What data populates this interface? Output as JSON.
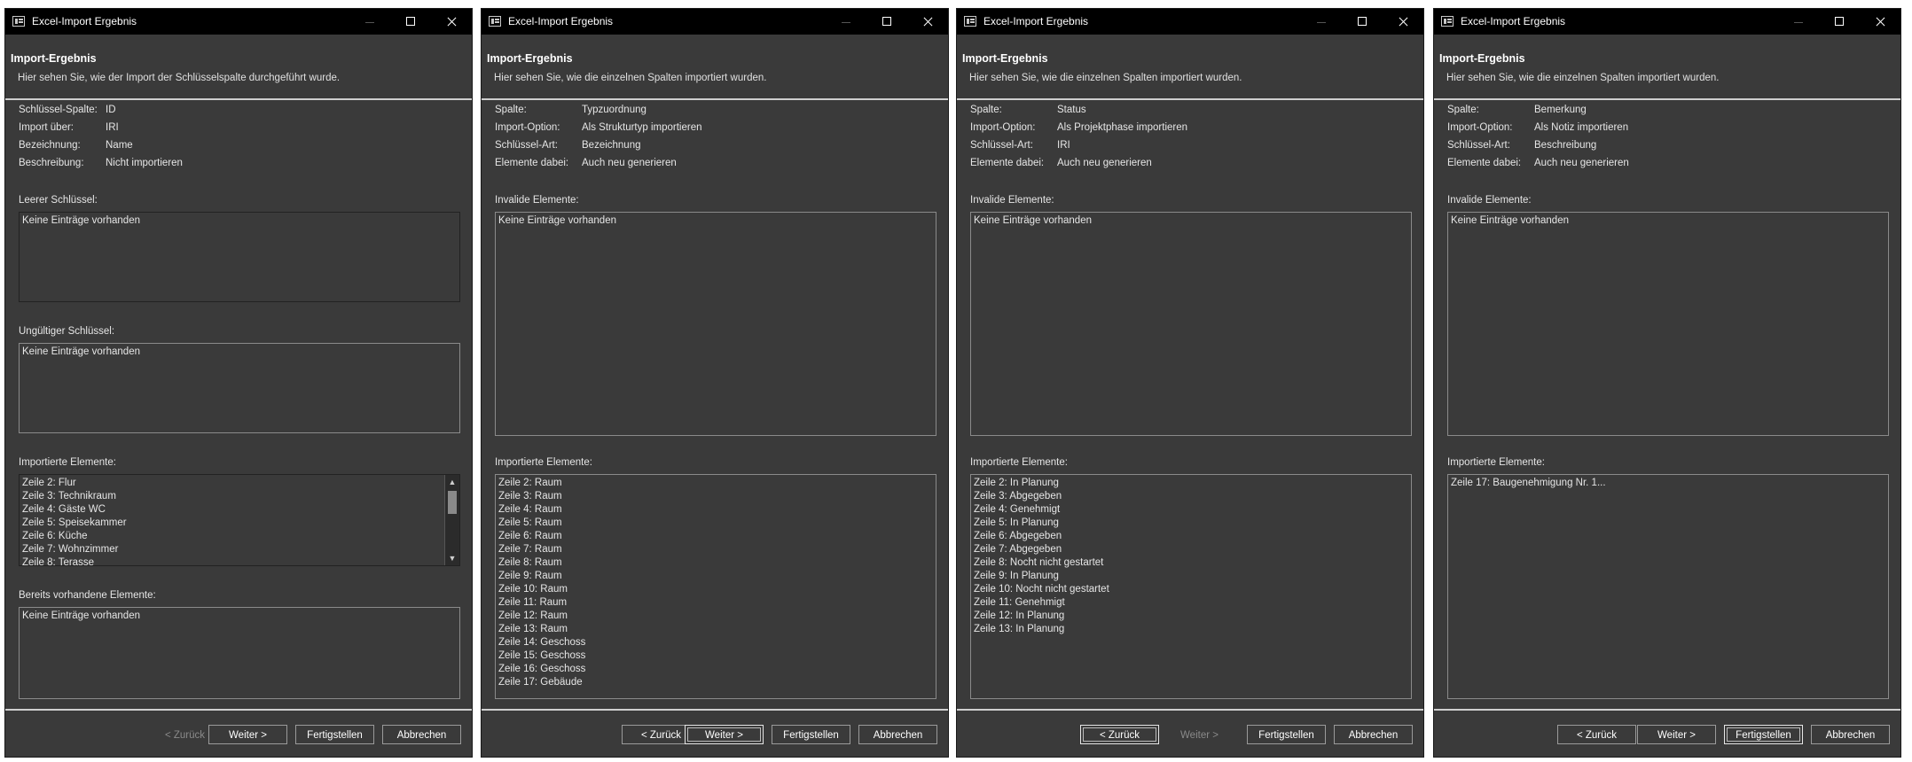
{
  "windows": [
    {
      "title": "Excel-Import Ergebnis",
      "header": {
        "title": "Import-Ergebnis",
        "desc": "Hier sehen Sie, wie der Import der Schlüsselspalte durchgeführt wurde."
      },
      "info": [
        {
          "label": "Schlüssel-Spalte:",
          "value": "ID"
        },
        {
          "label": "Import über:",
          "value": "IRI"
        },
        {
          "label": "Bezeichnung:",
          "value": "Name"
        },
        {
          "label": "Beschreibung:",
          "value": "Nicht importieren"
        }
      ],
      "sections": [
        {
          "label": "Leerer Schlüssel:",
          "items": [
            "Keine Einträge vorhanden"
          ]
        },
        {
          "label": "Ungültiger Schlüssel:",
          "items": [
            "Keine Einträge vorhanden"
          ]
        },
        {
          "label": "Importierte Elemente:",
          "items": [
            "Zeile 2: Flur",
            "Zeile 3: Technikraum",
            "Zeile 4: Gäste WC",
            "Zeile 5: Speisekammer",
            "Zeile 6: Küche",
            "Zeile 7: Wohnzimmer",
            "Zeile 8: Terasse"
          ]
        },
        {
          "label": "Bereits vorhandene Elemente:",
          "items": [
            "Keine Einträge vorhanden"
          ]
        }
      ],
      "buttons": {
        "back": "< Zurück",
        "next": "Weiter >",
        "finish": "Fertigstellen",
        "cancel": "Abbrechen"
      }
    },
    {
      "title": "Excel-Import Ergebnis",
      "header": {
        "title": "Import-Ergebnis",
        "desc": "Hier sehen Sie, wie die einzelnen Spalten importiert wurden."
      },
      "info": [
        {
          "label": "Spalte:",
          "value": "Typzuordnung"
        },
        {
          "label": "Import-Option:",
          "value": "Als Strukturtyp importieren"
        },
        {
          "label": "Schlüssel-Art:",
          "value": "Bezeichnung"
        },
        {
          "label": "Elemente dabei:",
          "value": "Auch neu generieren"
        }
      ],
      "sections": [
        {
          "label": "Invalide Elemente:",
          "items": [
            "Keine Einträge vorhanden"
          ]
        },
        {
          "label": "Importierte Elemente:",
          "items": [
            "Zeile 2: Raum",
            "Zeile 3: Raum",
            "Zeile 4: Raum",
            "Zeile 5: Raum",
            "Zeile 6: Raum",
            "Zeile 7: Raum",
            "Zeile 8: Raum",
            "Zeile 9: Raum",
            "Zeile 10: Raum",
            "Zeile 11: Raum",
            "Zeile 12: Raum",
            "Zeile 13: Raum",
            "Zeile 14: Geschoss",
            "Zeile 15: Geschoss",
            "Zeile 16: Geschoss",
            "Zeile 17: Gebäude"
          ]
        }
      ],
      "buttons": {
        "back": "< Zurück",
        "next": "Weiter >",
        "finish": "Fertigstellen",
        "cancel": "Abbrechen"
      }
    },
    {
      "title": "Excel-Import Ergebnis",
      "header": {
        "title": "Import-Ergebnis",
        "desc": "Hier sehen Sie, wie die einzelnen Spalten importiert wurden."
      },
      "info": [
        {
          "label": "Spalte:",
          "value": "Status"
        },
        {
          "label": "Import-Option:",
          "value": "Als Projektphase importieren"
        },
        {
          "label": "Schlüssel-Art:",
          "value": "IRI"
        },
        {
          "label": "Elemente dabei:",
          "value": "Auch neu generieren"
        }
      ],
      "sections": [
        {
          "label": "Invalide Elemente:",
          "items": [
            "Keine Einträge vorhanden"
          ]
        },
        {
          "label": "Importierte Elemente:",
          "items": [
            "Zeile 2: In Planung",
            "Zeile 3: Abgegeben",
            "Zeile 4: Genehmigt",
            "Zeile 5: In Planung",
            "Zeile 6: Abgegeben",
            "Zeile 7: Abgegeben",
            "Zeile 8: Nocht nicht gestartet",
            "Zeile 9: In Planung",
            "Zeile 10: Nocht nicht gestartet",
            "Zeile 11: Genehmigt",
            "Zeile 12: In Planung",
            "Zeile 13: In Planung"
          ]
        }
      ],
      "buttons": {
        "back": "< Zurück",
        "next": "Weiter >",
        "finish": "Fertigstellen",
        "cancel": "Abbrechen"
      }
    },
    {
      "title": "Excel-Import Ergebnis",
      "header": {
        "title": "Import-Ergebnis",
        "desc": "Hier sehen Sie, wie die einzelnen Spalten importiert wurden."
      },
      "info": [
        {
          "label": "Spalte:",
          "value": "Bemerkung"
        },
        {
          "label": "Import-Option:",
          "value": "Als Notiz importieren"
        },
        {
          "label": "Schlüssel-Art:",
          "value": "Beschreibung"
        },
        {
          "label": "Elemente dabei:",
          "value": "Auch neu generieren"
        }
      ],
      "sections": [
        {
          "label": "Invalide Elemente:",
          "items": [
            "Keine Einträge vorhanden"
          ]
        },
        {
          "label": "Importierte Elemente:",
          "items": [
            "Zeile 17: Baugenehmigung Nr. 1..."
          ]
        }
      ],
      "buttons": {
        "back": "< Zurück",
        "next": "Weiter >",
        "finish": "Fertigstellen",
        "cancel": "Abbrechen"
      }
    }
  ]
}
